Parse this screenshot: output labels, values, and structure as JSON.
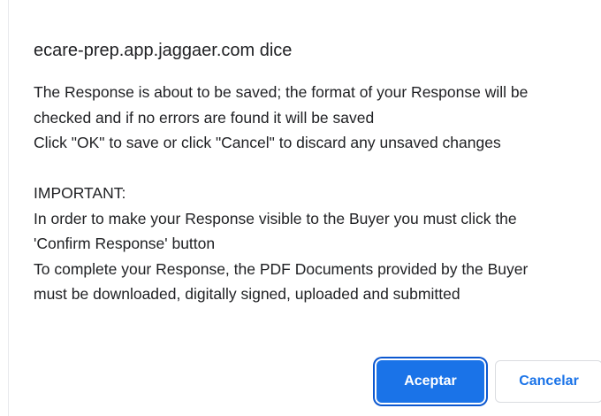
{
  "dialog": {
    "origin_title": "ecare-prep.app.jaggaer.com dice",
    "message_lines": [
      "The Response is about to be saved; the format of your Response will be",
      "checked and if no errors are found it will be saved",
      "Click \"OK\" to save or click \"Cancel\" to discard any unsaved changes",
      "",
      "IMPORTANT:",
      "In order to make your Response visible to the Buyer you must click the",
      "'Confirm Response' button",
      "To complete your Response, the PDF Documents provided by the Buyer",
      "must be downloaded, digitally signed, uploaded and submitted"
    ],
    "accept_label": "Aceptar",
    "cancel_label": "Cancelar"
  },
  "colors": {
    "primary": "#1a73e8",
    "text": "#202124",
    "focus_ring": "#0b57d0"
  }
}
